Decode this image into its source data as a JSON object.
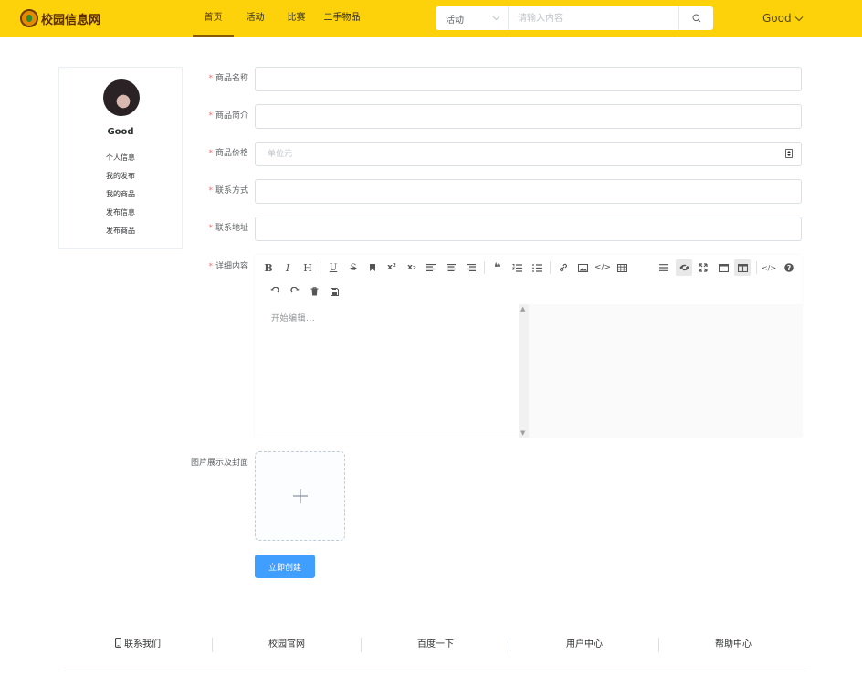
{
  "header": {
    "logo_text": "校园信息网",
    "nav": [
      {
        "label": "首页",
        "active": true
      },
      {
        "label": "活动",
        "active": false
      },
      {
        "label": "比赛",
        "active": false
      },
      {
        "label": "二手物品",
        "active": false
      }
    ],
    "search": {
      "category": "活动",
      "placeholder": "请输入内容"
    },
    "user_name": "Good"
  },
  "sidebar": {
    "user_name": "Good",
    "items": [
      "个人信息",
      "我的发布",
      "我的商品",
      "发布信息",
      "发布商品"
    ]
  },
  "form": {
    "fields": [
      {
        "label": "商品名称",
        "required": true,
        "value": "",
        "placeholder": ""
      },
      {
        "label": "商品简介",
        "required": true,
        "value": "",
        "placeholder": ""
      },
      {
        "label": "商品价格",
        "required": true,
        "value": "",
        "placeholder": "单位元"
      },
      {
        "label": "联系方式",
        "required": true,
        "value": "",
        "placeholder": ""
      },
      {
        "label": "联系地址",
        "required": true,
        "value": "",
        "placeholder": ""
      }
    ],
    "detail_label": "详细内容",
    "editor_placeholder": "开始编辑...",
    "upload_label": "图片展示及封面",
    "submit_label": "立即创建"
  },
  "footer": {
    "items": [
      "联系我们",
      "校园官网",
      "百度一下",
      "用户中心",
      "帮助中心"
    ]
  },
  "colors": {
    "header_bg": "#fdd20a",
    "primary": "#409eff",
    "required": "#f56c6c"
  }
}
